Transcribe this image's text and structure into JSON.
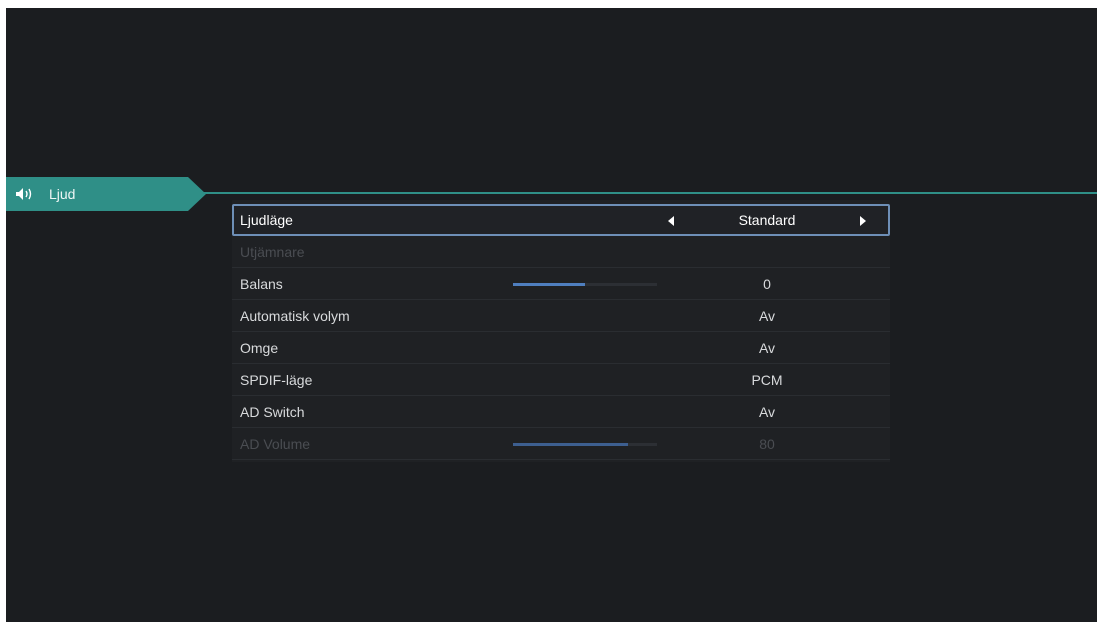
{
  "colors": {
    "accent": "#2f8f87",
    "slider_fill": "#4f7fbf",
    "slider_fill_disabled": "#3d5f90"
  },
  "tab": {
    "label": "Ljud",
    "icon": "speaker-icon"
  },
  "settings": [
    {
      "label": "Ljudläge",
      "value": "Standard",
      "selected": true
    },
    {
      "label": "Utjämnare",
      "value": "",
      "disabled": true
    },
    {
      "label": "Balans",
      "value": "0",
      "slider": 0.5
    },
    {
      "label": "Automatisk volym",
      "value": "Av"
    },
    {
      "label": "Omge",
      "value": "Av"
    },
    {
      "label": "SPDIF-läge",
      "value": "PCM"
    },
    {
      "label": "AD Switch",
      "value": "Av"
    },
    {
      "label": "AD Volume",
      "value": "80",
      "disabled": true,
      "slider": 0.8
    }
  ]
}
